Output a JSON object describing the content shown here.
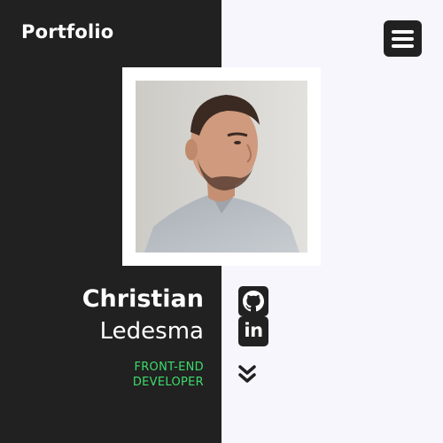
{
  "header": {
    "brand": "Portfolio",
    "menu_icon": "hamburger-menu-icon"
  },
  "profile": {
    "first_name": "Christian",
    "last_name": "Ledesma",
    "role_line1": "FRONT-END",
    "role_line2": "DEVELOPER"
  },
  "social": {
    "github_icon": "github-icon",
    "linkedin_icon": "linkedin-icon",
    "linkedin_glyph": "in"
  },
  "scroll": {
    "icon": "chevron-double-down-icon"
  },
  "colors": {
    "dark": "#212121",
    "light": "#f7f6fd",
    "accent": "#3ddc6b",
    "white": "#ffffff"
  }
}
